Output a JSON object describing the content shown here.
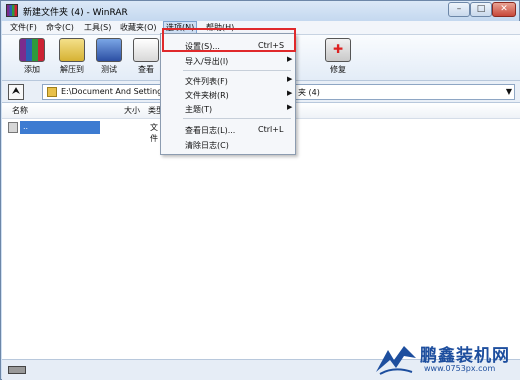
{
  "window": {
    "title": "新建文件夹 (4) - WinRAR",
    "controls": {
      "minimize": "–",
      "maximize": "□",
      "close": "✕"
    }
  },
  "menubar": {
    "items": [
      {
        "label": "文件(F)"
      },
      {
        "label": "命令(C)"
      },
      {
        "label": "工具(S)"
      },
      {
        "label": "收藏夹(O)"
      },
      {
        "label": "选项(N)",
        "active": true
      },
      {
        "label": "帮助(H)"
      }
    ]
  },
  "toolbar": {
    "buttons": [
      {
        "label": "添加",
        "icon": "add-archive-icon"
      },
      {
        "label": "解压到",
        "icon": "extract-icon"
      },
      {
        "label": "测试",
        "icon": "test-icon"
      },
      {
        "label": "查看",
        "icon": "view-icon"
      },
      {
        "label": "修复",
        "icon": "repair-icon"
      }
    ]
  },
  "address": {
    "path": "E:\\Document And Settings",
    "path_suffix": "夹 (4)",
    "dropdown_arrow": "▼"
  },
  "file_list": {
    "columns": [
      "名称",
      "大小",
      "类型"
    ],
    "rows": [
      {
        "name": "..",
        "type": "文件"
      }
    ]
  },
  "options_menu": {
    "items": [
      {
        "label": "设置(S)...",
        "shortcut": "Ctrl+S",
        "has_submenu": false,
        "highlighted": true
      },
      {
        "label": "导入/导出(I)",
        "shortcut": "",
        "has_submenu": true
      },
      {
        "label": "文件列表(F)",
        "shortcut": "",
        "has_submenu": true
      },
      {
        "label": "文件夹树(R)",
        "shortcut": "",
        "has_submenu": true
      },
      {
        "label": "主题(T)",
        "shortcut": "",
        "has_submenu": true
      },
      {
        "label": "查看日志(L)...",
        "shortcut": "Ctrl+L",
        "has_submenu": false
      },
      {
        "label": "清除日志(C)",
        "shortcut": "",
        "has_submenu": false
      }
    ],
    "submenu_arrow": "▶"
  },
  "watermark": {
    "name": "鹏鑫装机网",
    "url": "www.0753px.com"
  },
  "colors": {
    "highlight_border": "#e0292b",
    "selection": "#3d7bd1",
    "watermark": "#1d4e9e"
  }
}
